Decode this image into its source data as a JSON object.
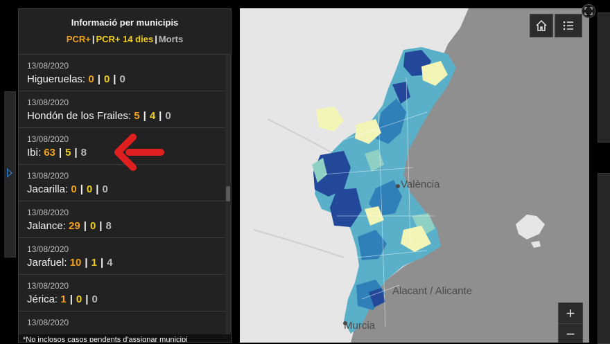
{
  "panel": {
    "title": "Informació per municipis",
    "legend": {
      "pcr": "PCR+",
      "pcr14": "PCR+ 14 dies",
      "morts": "Morts",
      "separator": "|"
    },
    "footnote": "*No inclosos casos pendents d'assignar municipi"
  },
  "items": [
    {
      "date": "13/08/2020",
      "name": "Higueruelas:",
      "pcr": "0",
      "pcr14": "0",
      "morts": "0"
    },
    {
      "date": "13/08/2020",
      "name": "Hondón de los Frailes:",
      "pcr": "5",
      "pcr14": "4",
      "morts": "0"
    },
    {
      "date": "13/08/2020",
      "name": "Ibi:",
      "pcr": "63",
      "pcr14": "5",
      "morts": "8"
    },
    {
      "date": "13/08/2020",
      "name": "Jacarilla:",
      "pcr": "0",
      "pcr14": "0",
      "morts": "0"
    },
    {
      "date": "13/08/2020",
      "name": "Jalance:",
      "pcr": "29",
      "pcr14": "0",
      "morts": "8"
    },
    {
      "date": "13/08/2020",
      "name": "Jarafuel:",
      "pcr": "10",
      "pcr14": "1",
      "morts": "4"
    },
    {
      "date": "13/08/2020",
      "name": "Jérica:",
      "pcr": "1",
      "pcr14": "0",
      "morts": "0"
    },
    {
      "date": "13/08/2020",
      "name": "",
      "pcr": "",
      "pcr14": "",
      "morts": ""
    }
  ],
  "map": {
    "labels": {
      "valencia": "València",
      "alacant": "Alacant / Alicante",
      "murcia": "Murcia"
    },
    "zoom_in": "+",
    "zoom_out": "−",
    "colors": {
      "sea": "#8f8f8f",
      "land": "#e6e6e6",
      "dark_blue": "#23489a",
      "mid_blue": "#2f7fb8",
      "light_blue": "#5ab0c8",
      "teal": "#8fd0c4",
      "pale_yellow": "#f3f5b7"
    }
  },
  "annotation": {
    "arrow_color": "#e02020"
  },
  "colors": {
    "pcr": "#f2a31b",
    "pcr14": "#f2cf1b",
    "morts": "#b8b8b8",
    "panel_bg": "#222222"
  }
}
